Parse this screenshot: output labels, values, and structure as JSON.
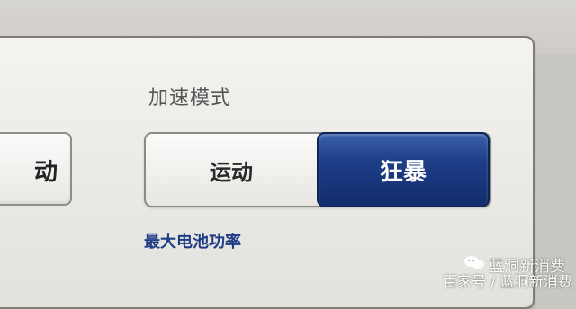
{
  "settings": {
    "section_label": "加速模式",
    "left_button_label": "动",
    "mode_options": [
      "运动",
      "狂暴"
    ],
    "selected_mode": "狂暴",
    "hint_text": "最大电池功率",
    "accent_color": "#1d3d86"
  },
  "watermark": {
    "name": "蓝洞新消费",
    "source": "百家号 / 蓝洞新消费",
    "icon": "wechat-icon"
  }
}
